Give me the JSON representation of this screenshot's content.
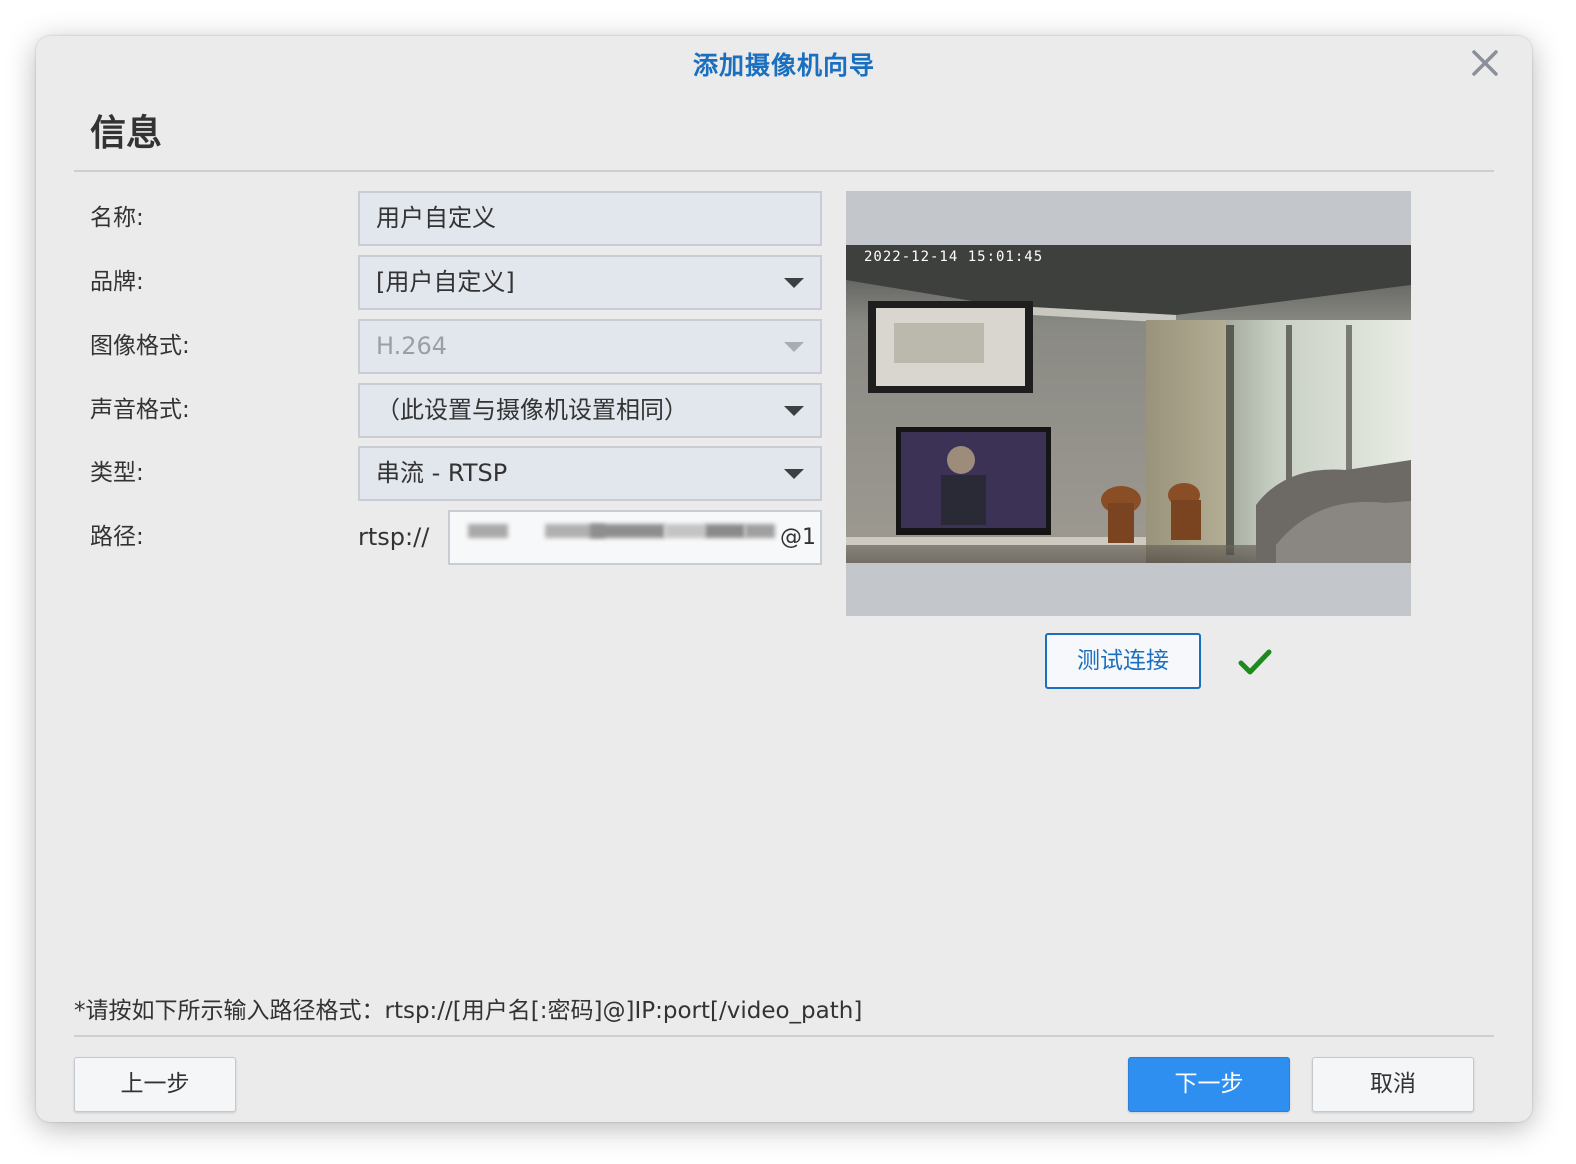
{
  "dialog": {
    "title": "添加摄像机向导",
    "section_title": "信息"
  },
  "form": {
    "name": {
      "label": "名称:",
      "value": "用户自定义"
    },
    "brand": {
      "label": "品牌:",
      "value": "[用户自定义]"
    },
    "video_format": {
      "label": "图像格式:",
      "value": "H.264",
      "disabled": true
    },
    "audio_format": {
      "label": "声音格式:",
      "value": "（此设置与摄像机设置相同）"
    },
    "type": {
      "label": "类型:",
      "value": "串流 - RTSP"
    },
    "path": {
      "label": "路径:",
      "prefix": "rtsp://",
      "visible_suffix": "@1"
    }
  },
  "preview": {
    "timestamp": "2022-12-14  15:01:45",
    "test_button_label": "测试连接",
    "status_icon": "check-icon",
    "status_color": "#1e8a1e"
  },
  "note": "*请按如下所示输入路径格式：rtsp://[用户名[:密码]@]IP:port[/video_path]",
  "footer": {
    "prev_label": "上一步",
    "next_label": "下一步",
    "cancel_label": "取消"
  },
  "colors": {
    "accent": "#1a6fbf",
    "primary_button": "#2f8ff0",
    "dialog_bg": "#ebebeb"
  }
}
